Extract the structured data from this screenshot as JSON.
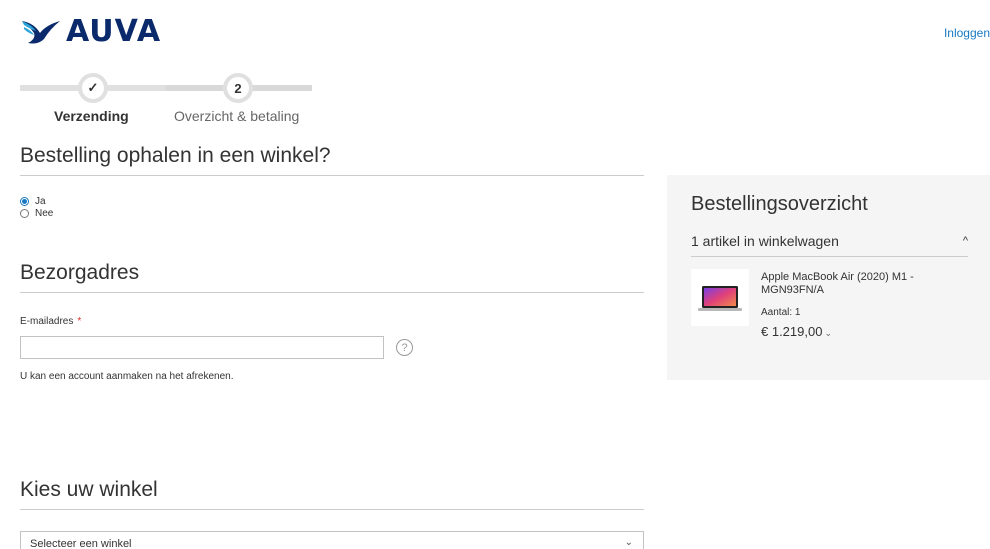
{
  "header": {
    "logo_text": "AUVA",
    "login_label": "Inloggen",
    "colors": {
      "brand": "#0a2a6b",
      "accent": "#2aa3d9",
      "link": "#1979c3"
    }
  },
  "progress": {
    "steps": [
      {
        "number": "✓",
        "label": "Verzending",
        "status": "completed"
      },
      {
        "number": "2",
        "label": "Overzicht & betaling",
        "status": "current"
      }
    ]
  },
  "pickup": {
    "title": "Bestelling ophalen in een winkel?",
    "options": [
      {
        "label": "Ja",
        "checked": true
      },
      {
        "label": "Nee",
        "checked": false
      }
    ]
  },
  "address": {
    "title": "Bezorgadres",
    "email_label": "E-mailadres",
    "required_mark": "*",
    "email_value": "",
    "help_icon": "?",
    "note": "U kan een account aanmaken na het afrekenen."
  },
  "store": {
    "title": "Kies uw winkel",
    "select_value": "Selecteer een winkel",
    "chevron": "⌄"
  },
  "summary": {
    "title": "Bestellingsoverzicht",
    "cart_count": "1 artikel in winkelwagen",
    "collapse_icon": "^",
    "item": {
      "name": "Apple MacBook Air (2020) M1 - MGN93FN/A",
      "qty": "Aantal: 1",
      "price": "€ 1.219,00",
      "price_chevron": "⌄"
    }
  }
}
